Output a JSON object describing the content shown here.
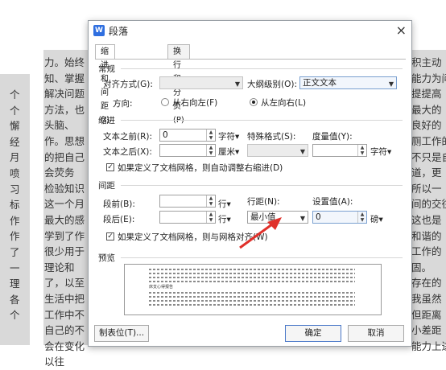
{
  "background_text": {
    "left_lines": [
      "个",
      "个",
      "懈",
      "经",
      "月",
      "喷",
      "习",
      "标",
      "作",
      "作",
      "了",
      "一",
      "理",
      "各",
      "个"
    ],
    "center_lines": [
      "力。始终",
      "知、掌握",
      "解决问题",
      "方法，也",
      "头脑、",
      "作。思想",
      "的把自己",
      "会荧务",
      "检验知识",
      "这一个月",
      "最大的感",
      "学到了作",
      "很少用于",
      "理论和",
      "了，以至",
      "生活中把",
      "工作中不",
      "自己的不",
      "会在变化",
      "以往"
    ],
    "right_lines": [
      "积主动",
      "能力为问",
      "提提高",
      "最大的",
      "良好的",
      "厕工作的",
      "不只是自",
      "道，更",
      "所以一",
      "间的交往",
      "这也是",
      "和谐的",
      "工作的",
      "固。",
      "存在的",
      "我虽然",
      "但距离",
      "小差距",
      "能力上进"
    ],
    "colors": {
      "right_highlight": "#c9c9c9"
    }
  },
  "dialog": {
    "title": "段落",
    "close_label": "×",
    "logo_text": "W",
    "tabs": [
      {
        "label": "缩进和间距(I)",
        "active": true
      },
      {
        "label": "换行和分页(P)",
        "active": false
      }
    ],
    "general": {
      "title": "常规",
      "align_label": "对齐方式(G):",
      "align_value": "",
      "outline_label": "大纲级别(O):",
      "outline_value": "正文文本",
      "direction_label": "方向:",
      "rtl_label": "从右向左(F)",
      "ltr_label": "从左向右(L)",
      "ltr_selected": true
    },
    "indent": {
      "title": "缩进",
      "before_label": "文本之前(R):",
      "before_value": "0",
      "before_unit": "字符▾",
      "special_label": "特殊格式(S):",
      "special_value": "",
      "measure_label": "度量值(Y):",
      "measure_value": "",
      "measure_unit": "字符▾",
      "after_label": "文本之后(X):",
      "after_value": "",
      "after_unit": "厘米▾",
      "auto_adjust_label": "如果定义了文档网格，则自动调整右缩进(D)",
      "auto_adjust_checked": true
    },
    "spacing": {
      "title": "间距",
      "before_label": "段前(B):",
      "before_value": "",
      "before_unit": "行▾",
      "after_label": "段后(E):",
      "after_value": "",
      "after_unit": "行▾",
      "line_label": "行距(N):",
      "line_value": "最小值",
      "setting_label": "设置值(A):",
      "setting_value": "0",
      "setting_unit": "磅▾",
      "grid_label": "如果定义了文档网格，则与网格对齐(W)",
      "grid_checked": true
    },
    "preview": {
      "title": "预览",
      "sample_text": "床支心得报告"
    },
    "buttons": {
      "tabs_label": "制表位(T)...",
      "ok_label": "确定",
      "cancel_label": "取消"
    },
    "colors": {
      "accent": "#2f6fe0",
      "arrow": "#e0302a"
    }
  }
}
